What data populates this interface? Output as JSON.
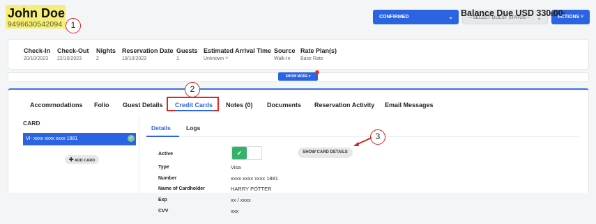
{
  "guest": {
    "name": "John Doe",
    "phone": "9496630542094"
  },
  "callouts": [
    "1",
    "2",
    "3"
  ],
  "header": {
    "status_button": "CONFIRMED",
    "guest_status_select": "– SELECT GUEST STATUS –",
    "actions_button": "ACTIONS"
  },
  "summary": {
    "fields": [
      {
        "label": "Check-In",
        "value": "20/10/2023"
      },
      {
        "label": "Check-Out",
        "value": "22/10/2023"
      },
      {
        "label": "Nights",
        "value": "2"
      },
      {
        "label": "Reservation Date",
        "value": "19/10/2023"
      },
      {
        "label": "Guests",
        "value": "1"
      },
      {
        "label": "Estimated Arrival Time",
        "value": "Unknown"
      },
      {
        "label": "Source",
        "value": "Walk-In"
      },
      {
        "label": "Rate Plan(s)",
        "value": "Base Rate"
      }
    ],
    "balance": "Balance Due USD 330.00",
    "show_more": "SHOW MORE"
  },
  "tabs": [
    "Accommodations",
    "Folio",
    "Guest Details",
    "Credit Cards",
    "Notes (0)",
    "Documents",
    "Reservation Activity",
    "Email Messages"
  ],
  "cards": {
    "header": "CARD",
    "items": [
      "VI- xxxx xxxx xxxx 1881"
    ],
    "add_button": "ADD CARD"
  },
  "subtabs": [
    "Details",
    "Logs"
  ],
  "details": {
    "show_card_button": "SHOW CARD DETAILS",
    "rows": [
      {
        "label": "Active",
        "value": ""
      },
      {
        "label": "Type",
        "value": "Visa"
      },
      {
        "label": "Number",
        "value": "xxxx xxxx xxxx 1881"
      },
      {
        "label": "Name of Cardholder",
        "value": "HARRY POTTER"
      },
      {
        "label": "Exp",
        "value": "xx / xxxx"
      },
      {
        "label": "CVV",
        "value": "xxx"
      }
    ]
  },
  "colors": {
    "accent": "#2b64e3",
    "highlight": "#f5ee7a",
    "callout": "#d62020",
    "toggle_on": "#35b26a"
  },
  "icons": [
    "chevron-down-icon",
    "hamburger-menu-icon",
    "check-icon",
    "plus-icon",
    "check-circle-icon"
  ]
}
